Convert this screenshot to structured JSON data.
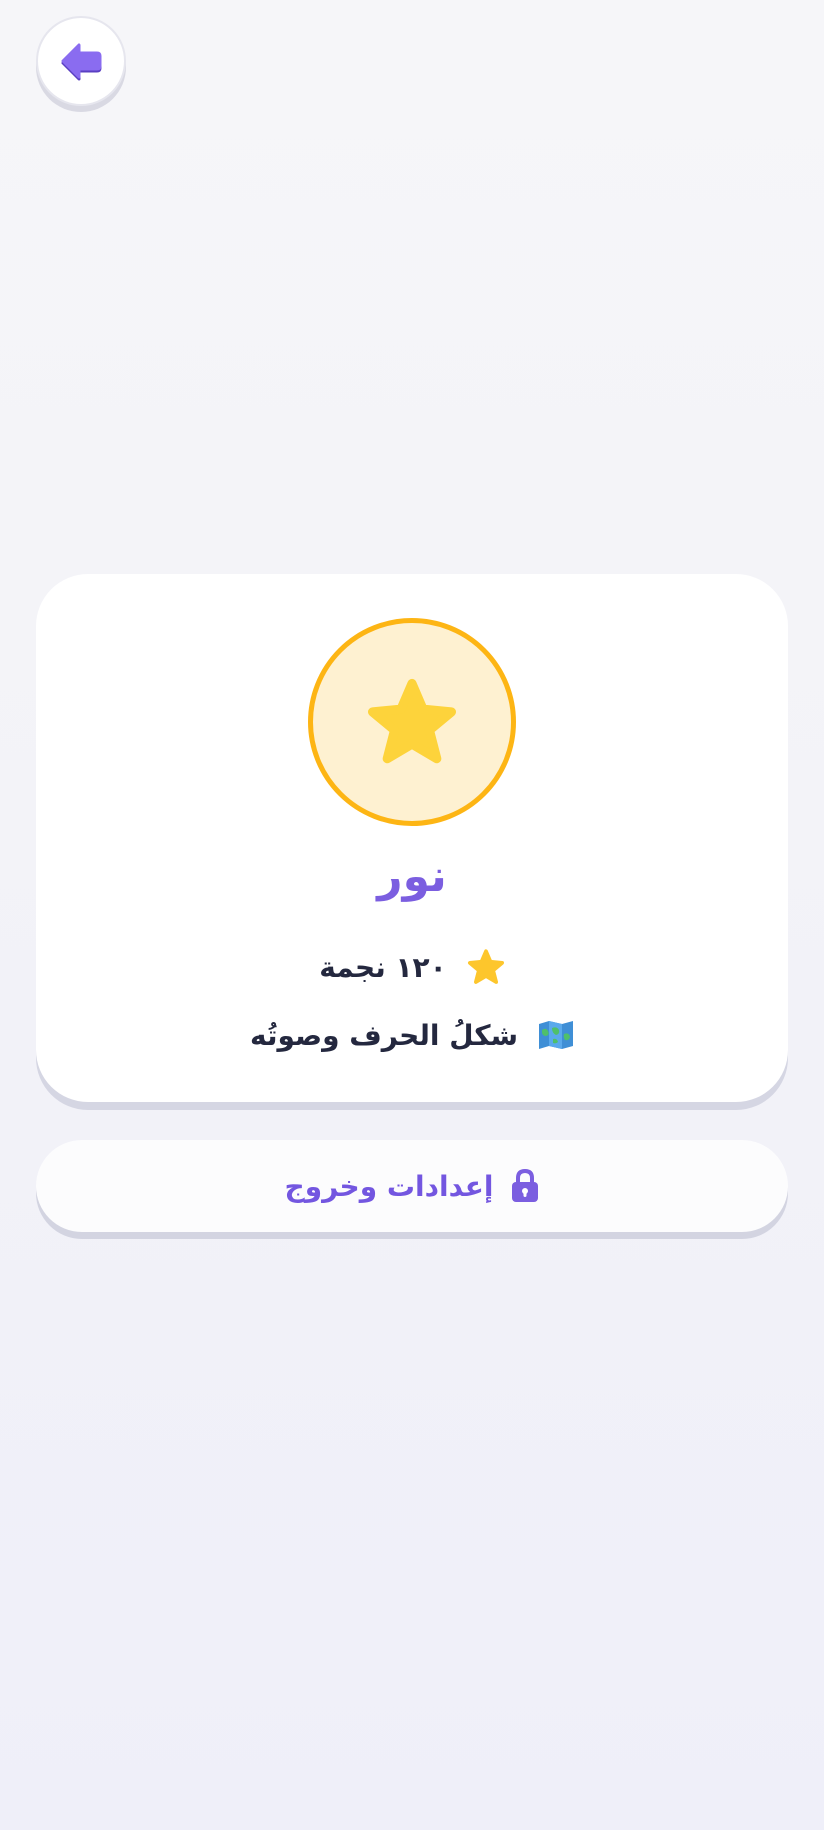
{
  "player": {
    "name": "نور",
    "stars_text": "١٢٠ نجمة",
    "level_text": "شكلُ الحرف وصوتُه"
  },
  "actions": {
    "settings_label": "إعدادات وخروج"
  },
  "icons": {
    "back": "arrow-left-icon",
    "avatar": "star-icon",
    "stars": "star-icon",
    "level": "map-icon",
    "settings": "lock-icon"
  },
  "colors": {
    "accent": "#7b5ee0",
    "gold": "#fdb514",
    "star": "#fdd33b",
    "text": "#24283f"
  }
}
